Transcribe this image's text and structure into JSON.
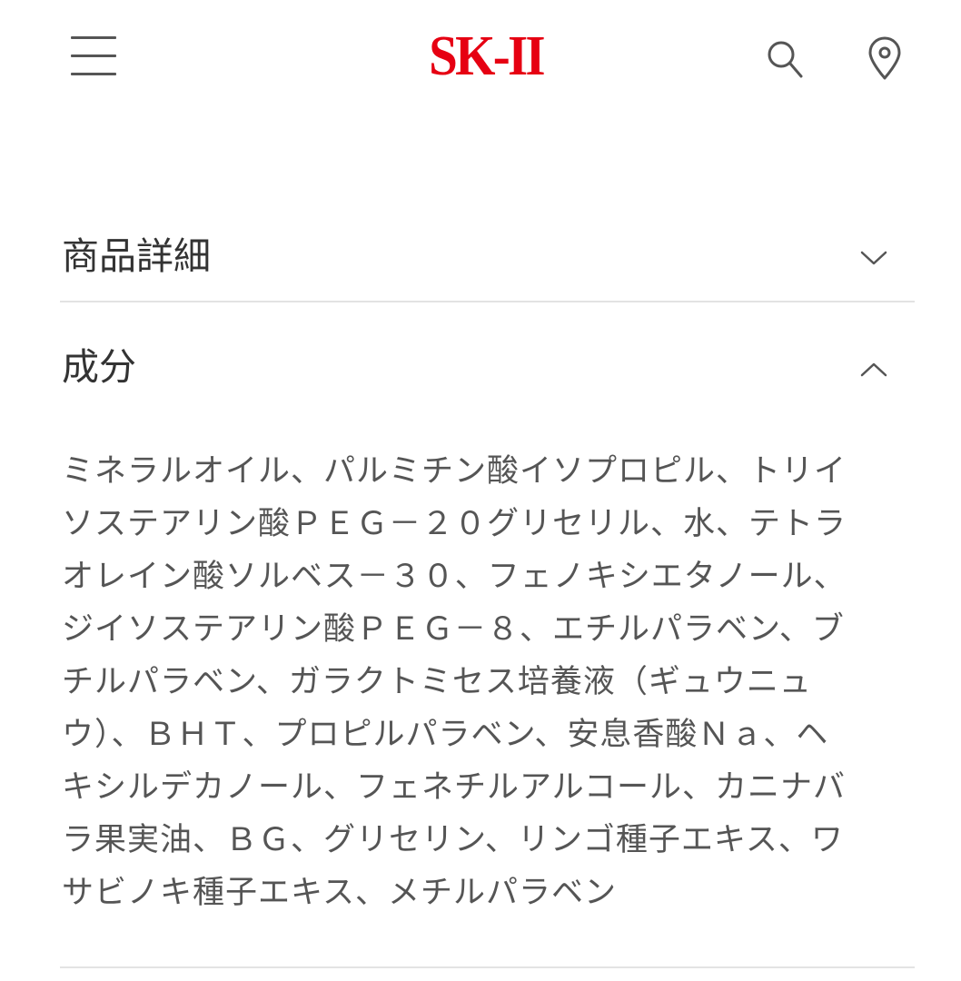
{
  "header": {
    "logo_text": "SK-II",
    "brand_color": "#e60012",
    "icons": [
      "hamburger-menu-icon",
      "search-icon",
      "map-pin-icon"
    ]
  },
  "accordion": [
    {
      "title": "商品詳細",
      "state": "collapsed"
    },
    {
      "title": "成分",
      "state": "expanded"
    }
  ],
  "ingredients": {
    "lines": [
      "ミネラルオイル、パルミチン酸イソプロピル、トリイ",
      "ソステアリン酸ＰＥＧ－２０グリセリル、水、テトラ",
      "オレイン酸ソルベス－３０、フェノキシエタノール、",
      "ジイソステアリン酸ＰＥＧ－８、エチルパラベン、ブ",
      "チルパラベン、ガラクトミセス培養液（ギュウニュ",
      "ウ）、ＢＨＴ、プロピルパラベン、安息香酸Ｎａ、ヘ",
      "キシルデカノール、フェネチルアルコール、カニナバ",
      "ラ果実油、ＢＧ、グリセリン、リンゴ種子エキス、ワ",
      "サビノキ種子エキス、メチルパラベン"
    ]
  }
}
